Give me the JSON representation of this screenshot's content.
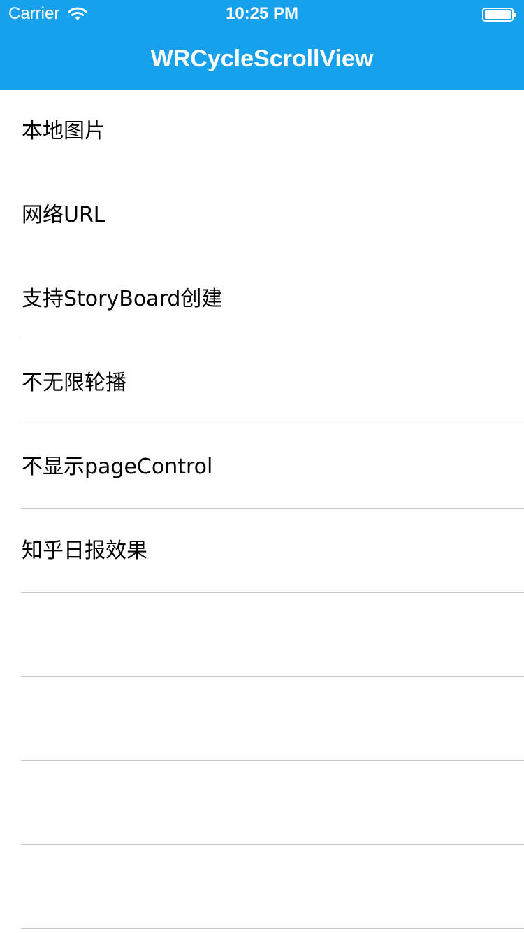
{
  "status_bar": {
    "carrier": "Carrier",
    "time": "10:25 PM",
    "wifi_icon": "wifi-icon",
    "battery_icon": "battery-icon"
  },
  "nav_bar": {
    "title": "WRCycleScrollView",
    "background_color": "#17a1ec"
  },
  "menu": {
    "items": [
      {
        "label": "本地图片"
      },
      {
        "label": "网络URL"
      },
      {
        "label": "支持StoryBoard创建"
      },
      {
        "label": "不无限轮播"
      },
      {
        "label": "不显示pageControl"
      },
      {
        "label": "知乎日报效果"
      },
      {
        "label": ""
      },
      {
        "label": ""
      },
      {
        "label": ""
      },
      {
        "label": ""
      }
    ]
  }
}
